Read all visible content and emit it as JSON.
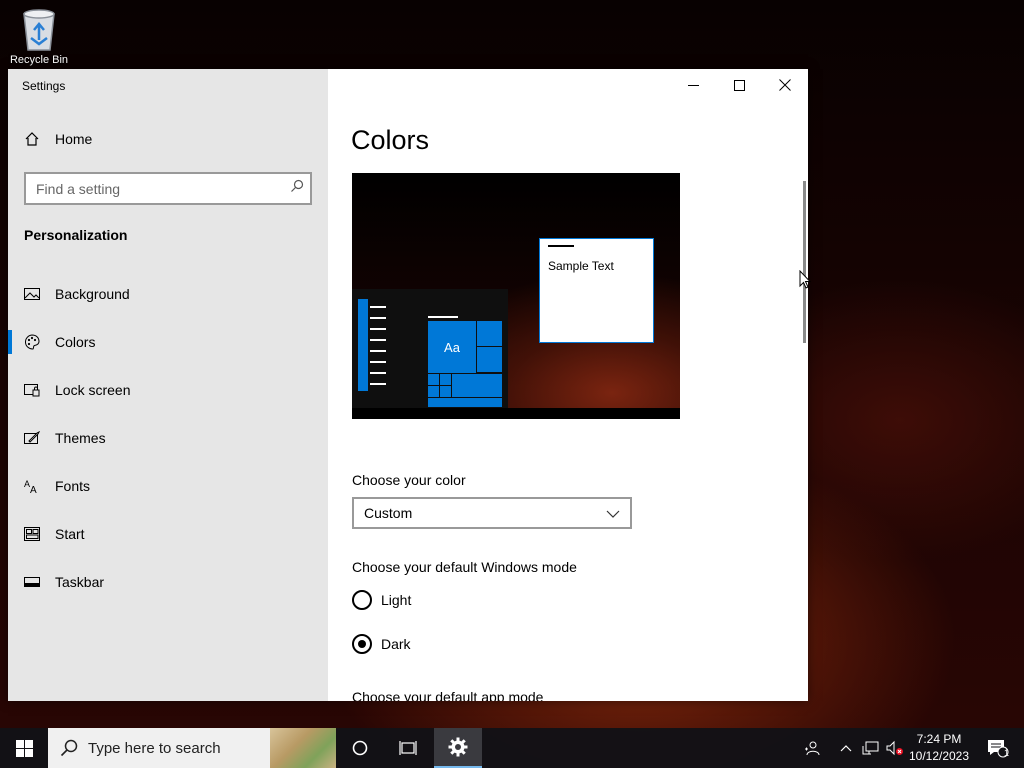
{
  "desktop": {
    "recycle_bin_label": "Recycle Bin"
  },
  "window": {
    "title": "Settings",
    "controls": [
      "minimize",
      "maximize",
      "close"
    ]
  },
  "sidebar": {
    "home_label": "Home",
    "search_placeholder": "Find a setting",
    "section_title": "Personalization",
    "items": [
      {
        "label": "Background",
        "icon": "picture-icon"
      },
      {
        "label": "Colors",
        "icon": "palette-icon",
        "selected": true
      },
      {
        "label": "Lock screen",
        "icon": "lock-screen-icon"
      },
      {
        "label": "Themes",
        "icon": "themes-icon"
      },
      {
        "label": "Fonts",
        "icon": "fonts-icon"
      },
      {
        "label": "Start",
        "icon": "start-icon"
      },
      {
        "label": "Taskbar",
        "icon": "taskbar-icon"
      }
    ]
  },
  "main": {
    "title": "Colors",
    "preview": {
      "sample_text": "Sample Text",
      "tile_text": "Aa"
    },
    "choose_color_label": "Choose your color",
    "choose_color_value": "Custom",
    "windows_mode_label": "Choose your default Windows mode",
    "windows_mode_options": [
      {
        "label": "Light",
        "checked": false
      },
      {
        "label": "Dark",
        "checked": true
      }
    ],
    "app_mode_label": "Choose your default app mode"
  },
  "taskbar": {
    "search_placeholder": "Type here to search",
    "time": "7:24 PM",
    "date": "10/12/2023",
    "notification_count": "1"
  },
  "colors": {
    "accent": "#0078d7",
    "sidebar_bg": "#e6e6e6",
    "taskbar_bg": "#121216"
  }
}
